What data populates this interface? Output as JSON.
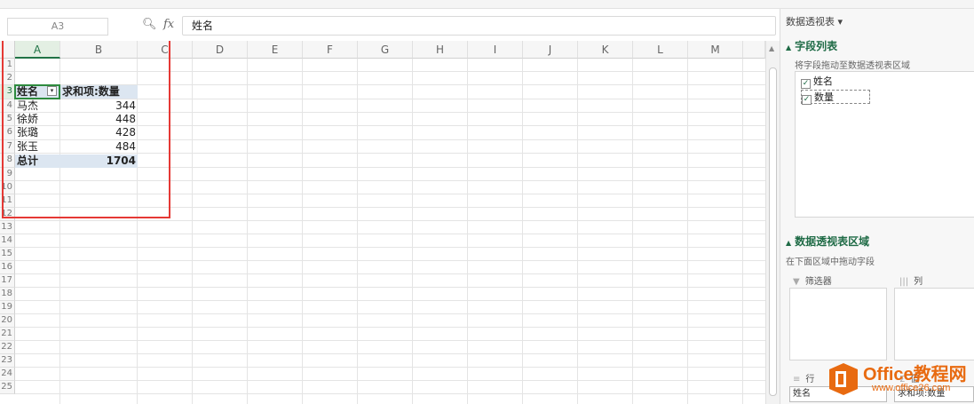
{
  "formula_bar": {
    "name_box": "A3",
    "formula": "姓名",
    "fx_label": "fx"
  },
  "columns": [
    "A",
    "B",
    "C",
    "D",
    "E",
    "F",
    "G",
    "H",
    "I",
    "J",
    "K",
    "L",
    "M"
  ],
  "rows": [
    "1",
    "2",
    "3",
    "4",
    "5",
    "6",
    "7",
    "8",
    "9",
    "10",
    "11",
    "12",
    "13",
    "14",
    "15",
    "16",
    "17",
    "18",
    "19",
    "20",
    "21",
    "22",
    "23",
    "24",
    "25"
  ],
  "pivot": {
    "header_name": "姓名",
    "header_value": "求和项:数量",
    "rows": [
      {
        "name": "马杰",
        "value": "344"
      },
      {
        "name": "徐娇",
        "value": "448"
      },
      {
        "name": "张璐",
        "value": "428"
      },
      {
        "name": "张玉",
        "value": "484"
      }
    ],
    "total_label": "总计",
    "total_value": "1704"
  },
  "panel": {
    "title": "数据透视表 ▾",
    "field_list_title": "字段列表",
    "field_list_hint": "将字段拖动至数据透视表区域",
    "fields": [
      {
        "label": "姓名",
        "checked": true
      },
      {
        "label": "数量",
        "checked": true
      }
    ],
    "areas_title": "数据透视表区域",
    "areas_hint": "在下面区域中拖动字段",
    "filter_label": "筛选器",
    "column_label": "列",
    "row_label": "行",
    "value_label": "值",
    "row_chip": "姓名",
    "value_chip": "求和项:数量"
  },
  "watermark": {
    "title": "Office教程网",
    "url": "www.office26.com"
  }
}
